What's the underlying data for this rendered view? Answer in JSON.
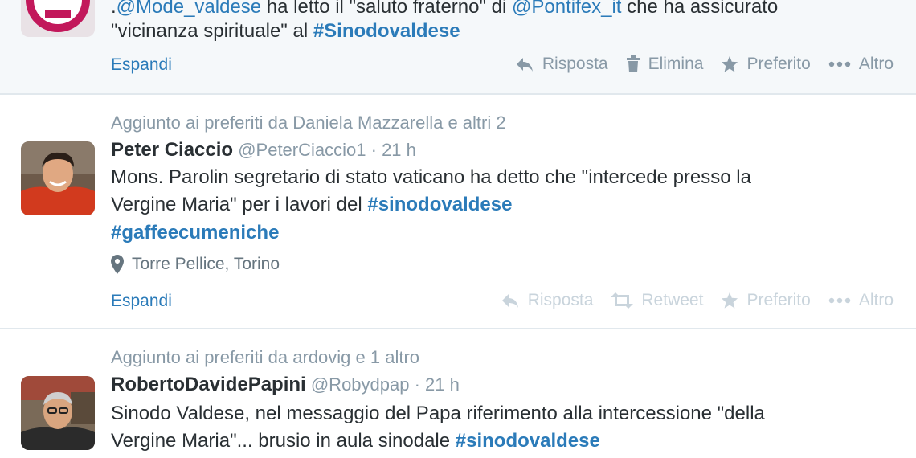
{
  "tweet1": {
    "text_line1_parts": [
      ".",
      "@Mode_valdese",
      " ha letto il \"saluto fraterno\" di ",
      "@Pontifex_it",
      " che ha assicurato"
    ],
    "text_line2_parts": [
      "\"vicinanza spirituale\" al ",
      "#Sinodovaldese"
    ],
    "expand": "Espandi",
    "actions": {
      "reply": "Risposta",
      "delete": "Elimina",
      "favorite": "Preferito",
      "more": "Altro"
    }
  },
  "tweet2": {
    "context": "Aggiunto ai preferiti da Daniela Mazzarella e altri 2",
    "fullname": "Peter Ciaccio",
    "username": "@PeterCiaccio1",
    "time": "· 21 h",
    "line1": "Mons. Parolin segretario di stato vaticano ha detto che \"intercede presso la",
    "line2_text": "Vergine Maria\" per i lavori del ",
    "line2_tag": "#sinodovaldese",
    "line3_tag": "#gaffeecumeniche",
    "location": "Torre Pellice, Torino",
    "expand": "Espandi",
    "actions": {
      "reply": "Risposta",
      "retweet": "Retweet",
      "favorite": "Preferito",
      "more": "Altro"
    }
  },
  "tweet3": {
    "context": "Aggiunto ai preferiti da ardovig e 1 altro",
    "fullname": "RobertoDavidePapini",
    "username": "@Robydpap",
    "time": "· 21 h",
    "line1": "Sinodo Valdese, nel messaggio del Papa riferimento alla intercessione \"della",
    "line2_text": "Vergine Maria\"... brusio in aula sinodale ",
    "line2_tag": "#sinodovaldese"
  },
  "colors": {
    "link": "#2b7bb9",
    "muted": "#8899a6",
    "text": "#292f33",
    "divider": "#e1e8ed"
  }
}
